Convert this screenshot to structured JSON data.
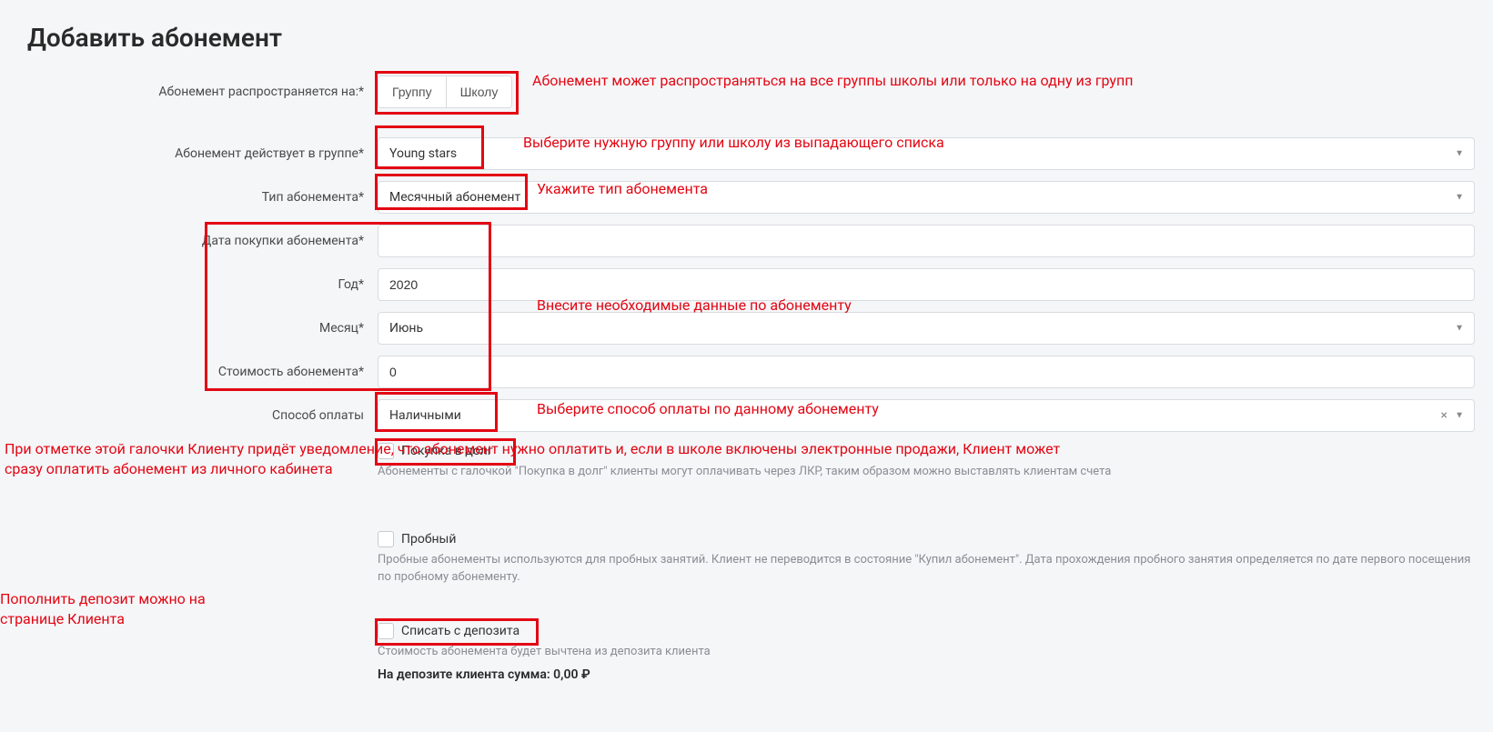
{
  "title": "Добавить абонемент",
  "fields": {
    "applies_to": {
      "label": "Абонемент распространяется на:*",
      "option_group": "Группу",
      "option_school": "Школу"
    },
    "group": {
      "label": "Абонемент действует в группе*",
      "value": "Young stars"
    },
    "type": {
      "label": "Тип абонемента*",
      "value": "Месячный абонемент"
    },
    "purchase_date": {
      "label": "Дата покупки абонемента*",
      "value": ""
    },
    "year": {
      "label": "Год*",
      "value": "2020"
    },
    "month": {
      "label": "Месяц*",
      "value": "Июнь"
    },
    "cost": {
      "label": "Стоимость абонемента*",
      "value": "0"
    },
    "payment": {
      "label": "Способ оплаты",
      "value": "Наличными"
    },
    "debt": {
      "label": "Покупка в долг",
      "help": "Абонементы с галочкой \"Покупка в долг\" клиенты могут оплачивать через ЛКР, таким образом можно выставлять клиентам счета"
    },
    "trial": {
      "label": "Пробный",
      "help": "Пробные абонементы используются для пробных занятий. Клиент не переводится в состояние \"Купил абонемент\". Дата прохождения пробного занятия определяется по дате первого посещения по пробному абонементу."
    },
    "deposit": {
      "label": "Списать с депозита",
      "help": "Стоимость абонемента будет вычтена из депозита клиента",
      "amount": "На депозите клиента сумма: 0,00 ₽"
    }
  },
  "annotations": {
    "applies_to": "Абонемент может распространяться на все группы школы или только на одну из групп",
    "group": "Выберите нужную группу или школу из выпадающего списка",
    "type": "Укажите тип абонемента",
    "data_block": "Внесите необходимые данные по абонементу",
    "payment": "Выберите способ оплаты по данному абонементу",
    "debt_note": "При отметке этой галочки Клиенту придёт уведомление, что абонемент нужно оплатить и, если в школе включены электронные продажи, Клиент может сразу оплатить абонемент из личного кабинета",
    "deposit_note": "Пополнить депозит можно на странице Клиента"
  }
}
